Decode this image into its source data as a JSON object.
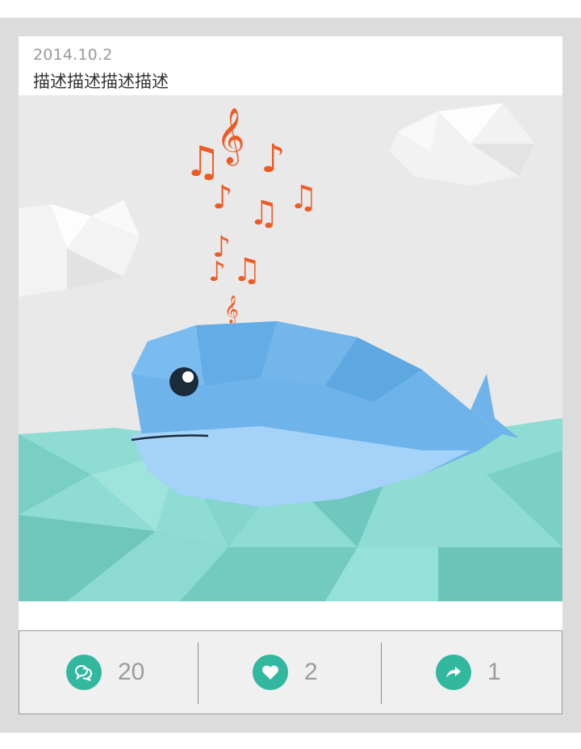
{
  "post": {
    "date": "2014.10.2",
    "description": "描述描述描述描述"
  },
  "image": {
    "subject": "low-poly whale with music notes",
    "colors": {
      "sky": "#e9e9e9",
      "sea": "#7fd6cd",
      "whale": "#6fb3e8",
      "notes": "#f15a24"
    }
  },
  "actions": {
    "comments": {
      "icon": "comment-icon",
      "count": "20"
    },
    "likes": {
      "icon": "heart-icon",
      "count": "2"
    },
    "shares": {
      "icon": "share-icon",
      "count": "1"
    }
  },
  "accent": "#33b8a0"
}
